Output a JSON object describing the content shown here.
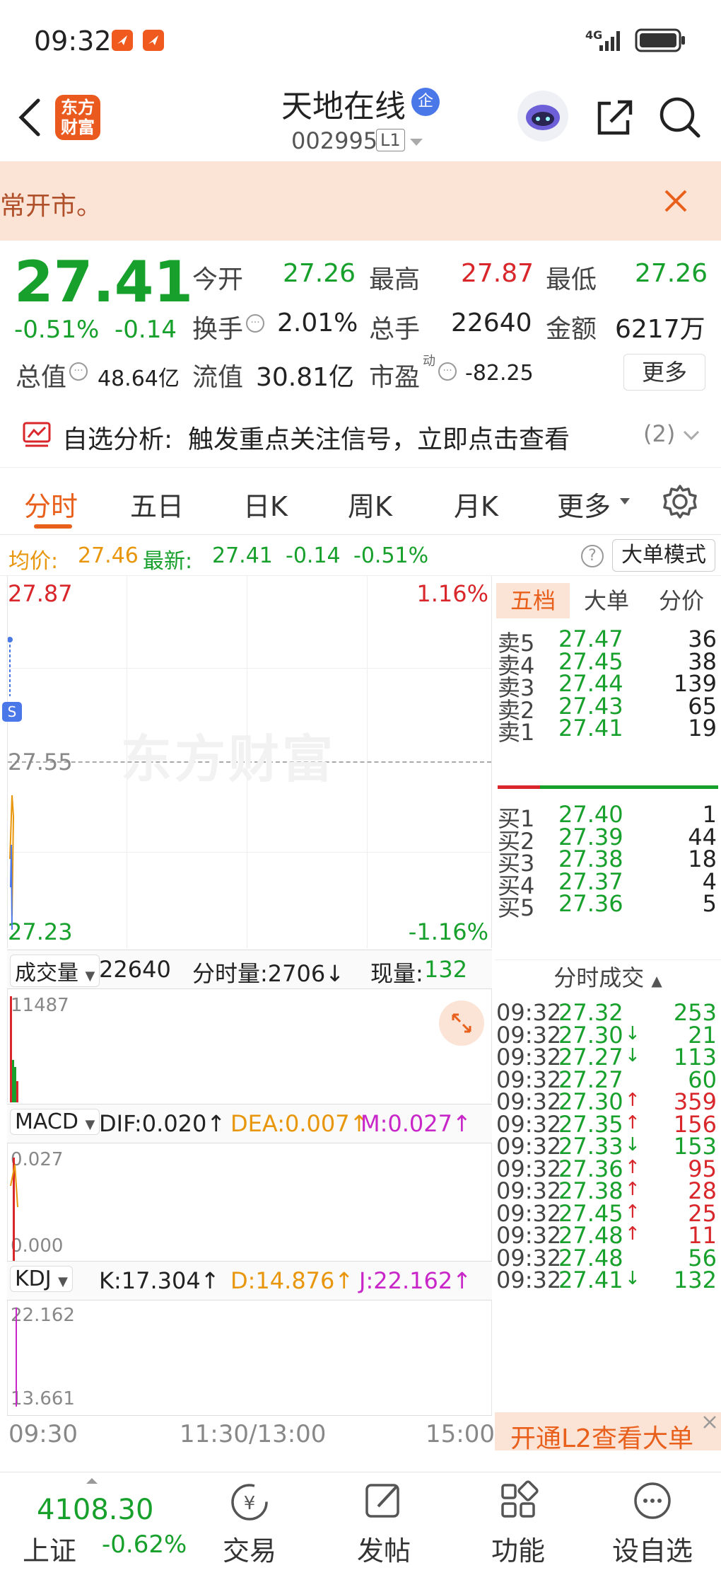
{
  "status": {
    "time": "09:32",
    "network": "4G"
  },
  "header": {
    "logo_text": "东方财富",
    "stock_name": "天地在线",
    "badge": "企",
    "stock_code": "002995",
    "level": "L1"
  },
  "notice": {
    "text": "常开市。"
  },
  "quote": {
    "price": "27.41",
    "change_pct": "-0.51%",
    "change_abs": "-0.14",
    "open_label": "今开",
    "open_value": "27.26",
    "high_label": "最高",
    "high_value": "27.87",
    "low_label": "最低",
    "low_value": "27.26",
    "turnover_label": "换手",
    "turnover_value": "2.01%",
    "volume_label": "总手",
    "volume_value": "22640",
    "amount_label": "金额",
    "amount_value": "6217万",
    "mktcap_label": "总值",
    "mktcap_value": "48.64亿",
    "float_label": "流值",
    "float_value": "30.81亿",
    "pe_label": "市盈",
    "pe_sup": "动",
    "pe_value": "-82.25",
    "more_button": "更多"
  },
  "analysis": {
    "label": "自选分析:",
    "text": "触发重点关注信号，立即点击查看",
    "count": "(2)"
  },
  "tabs": [
    "分时",
    "五日",
    "日K",
    "周K",
    "月K",
    "更多"
  ],
  "avgbar": {
    "avg_label": "均价:",
    "avg_value": "27.46",
    "latest_label": "最新:",
    "latest_value": "27.41",
    "change_abs": "-0.14",
    "change_pct": "-0.51%",
    "mode_button": "大单模式"
  },
  "chart": {
    "price_top": "27.87",
    "pct_top": "1.16%",
    "price_mid": "27.55",
    "price_bottom": "27.23",
    "pct_bottom": "-1.16%",
    "marker": "S",
    "watermark": "东方财富",
    "volume_selector": "成交量",
    "volume_total": "22640",
    "volume_period_label": "分时量:2706↓",
    "volume_now_label": "现量:",
    "volume_now": "132",
    "volume_max": "11487",
    "macd_selector": "MACD",
    "macd_dif": "DIF:0.020↑",
    "macd_dea": "DEA:0.007↑",
    "macd_m": "M:0.027↑",
    "macd_top": "0.027",
    "macd_bottom": "0.000",
    "kdj_selector": "KDJ",
    "kdj_k": "K:17.304↑",
    "kdj_d": "D:14.876↑",
    "kdj_j": "J:22.162↑",
    "kdj_top": "22.162",
    "kdj_bottom": "13.661",
    "time_start": "09:30",
    "time_mid": "11:30/13:00",
    "time_end": "15:00"
  },
  "orderbook": {
    "tabs": [
      "五档",
      "大单",
      "分价"
    ],
    "asks": [
      {
        "label": "卖5",
        "price": "27.47",
        "vol": "36"
      },
      {
        "label": "卖4",
        "price": "27.45",
        "vol": "38"
      },
      {
        "label": "卖3",
        "price": "27.44",
        "vol": "139"
      },
      {
        "label": "卖2",
        "price": "27.43",
        "vol": "65"
      },
      {
        "label": "卖1",
        "price": "27.41",
        "vol": "19"
      }
    ],
    "bids": [
      {
        "label": "买1",
        "price": "27.40",
        "vol": "1"
      },
      {
        "label": "买2",
        "price": "27.39",
        "vol": "44"
      },
      {
        "label": "买3",
        "price": "27.38",
        "vol": "18"
      },
      {
        "label": "买4",
        "price": "27.37",
        "vol": "4"
      },
      {
        "label": "买5",
        "price": "27.36",
        "vol": "5"
      }
    ]
  },
  "trades": {
    "title": "分时成交",
    "rows": [
      {
        "time": "09:32",
        "price": "27.32",
        "arrow": "",
        "vol": "253",
        "pc": "green",
        "vc": "green"
      },
      {
        "time": "09:32",
        "price": "27.30",
        "arrow": "↓",
        "vol": "21",
        "pc": "green",
        "vc": "green"
      },
      {
        "time": "09:32",
        "price": "27.27",
        "arrow": "↓",
        "vol": "113",
        "pc": "green",
        "vc": "green"
      },
      {
        "time": "09:32",
        "price": "27.27",
        "arrow": "",
        "vol": "60",
        "pc": "green",
        "vc": "green"
      },
      {
        "time": "09:32",
        "price": "27.30",
        "arrow": "↑",
        "vol": "359",
        "pc": "green",
        "vc": "red"
      },
      {
        "time": "09:32",
        "price": "27.35",
        "arrow": "↑",
        "vol": "156",
        "pc": "green",
        "vc": "red"
      },
      {
        "time": "09:32",
        "price": "27.33",
        "arrow": "↓",
        "vol": "153",
        "pc": "green",
        "vc": "green"
      },
      {
        "time": "09:32",
        "price": "27.36",
        "arrow": "↑",
        "vol": "95",
        "pc": "green",
        "vc": "red"
      },
      {
        "time": "09:32",
        "price": "27.38",
        "arrow": "↑",
        "vol": "28",
        "pc": "green",
        "vc": "red"
      },
      {
        "time": "09:32",
        "price": "27.45",
        "arrow": "↑",
        "vol": "25",
        "pc": "green",
        "vc": "red"
      },
      {
        "time": "09:32",
        "price": "27.48",
        "arrow": "↑",
        "vol": "11",
        "pc": "green",
        "vc": "red"
      },
      {
        "time": "09:32",
        "price": "27.48",
        "arrow": "",
        "vol": "56",
        "pc": "green",
        "vc": "green"
      },
      {
        "time": "09:32",
        "price": "27.41",
        "arrow": "↓",
        "vol": "132",
        "pc": "green",
        "vc": "green"
      }
    ],
    "promo": "开通L2查看大单"
  },
  "bottom_nav": {
    "index_value": "4108.30",
    "index_name": "上证",
    "index_change": "-0.62%",
    "items": [
      "交易",
      "发帖",
      "功能",
      "设自选"
    ]
  },
  "colors": {
    "up": "#d8262a",
    "down": "#18a02c",
    "accent": "#e8601c",
    "avg": "#e8960c",
    "macd_m": "#c826c8"
  }
}
